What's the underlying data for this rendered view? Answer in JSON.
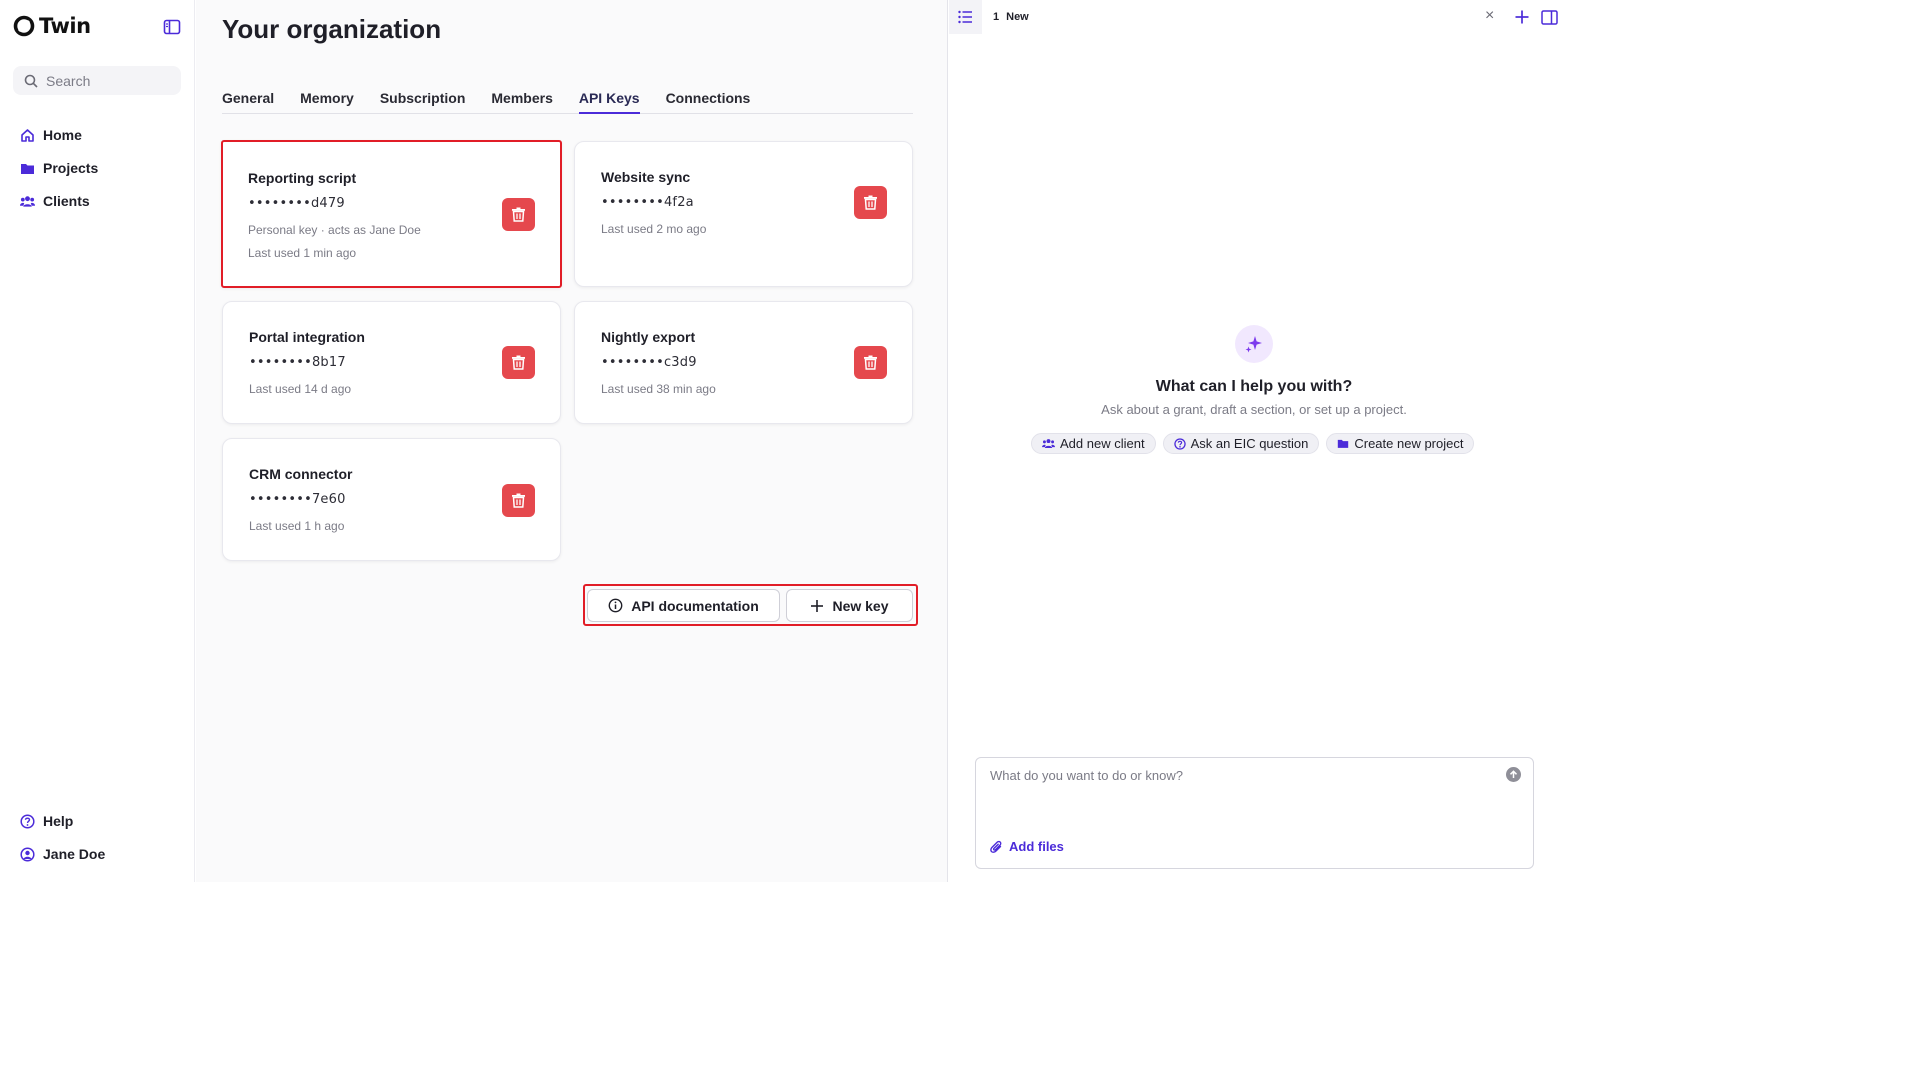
{
  "app": {
    "brand": "Twin"
  },
  "colors": {
    "accent": "#4b2bd9",
    "danger": "#e5484d",
    "highlight": "#e11d27",
    "purple_icon": "#7c3aed"
  },
  "sidebar": {
    "search_placeholder": "Search",
    "items": [
      {
        "label": "Home",
        "icon": "home-icon"
      },
      {
        "label": "Projects",
        "icon": "folder-icon"
      },
      {
        "label": "Clients",
        "icon": "users-icon"
      }
    ],
    "bottom": [
      {
        "label": "Help",
        "icon": "help-circle-icon"
      },
      {
        "label": "Jane Doe",
        "icon": "user-circle-icon"
      }
    ]
  },
  "main": {
    "title": "Your organization",
    "tabs": [
      {
        "label": "General"
      },
      {
        "label": "Memory"
      },
      {
        "label": "Subscription"
      },
      {
        "label": "Members"
      },
      {
        "label": "API Keys",
        "active": true
      },
      {
        "label": "Connections"
      }
    ],
    "keys": [
      {
        "name": "Reporting script",
        "key": "••••••••d479",
        "note": "Personal key · acts as Jane Doe",
        "last_used": "Last used 1 min ago",
        "highlighted": true
      },
      {
        "name": "Website sync",
        "key": "••••••••4f2a",
        "last_used": "Last used 2 mo ago"
      },
      {
        "name": "Portal integration",
        "key": "••••••••8b17",
        "last_used": "Last used 14 d ago"
      },
      {
        "name": "Nightly export",
        "key": "••••••••c3d9",
        "last_used": "Last used 38 min ago"
      },
      {
        "name": "CRM connector",
        "key": "••••••••7e60",
        "last_used": "Last used 1 h ago"
      }
    ],
    "actions": {
      "docs_label": "API documentation",
      "new_key_label": "New key"
    }
  },
  "right_panel": {
    "tab_number": "1",
    "tab_label": "New",
    "close_glyph": "×",
    "help_title": "What can I help you with?",
    "help_sub": "Ask about a grant, draft a section, or set up a project.",
    "chips": [
      {
        "label": "Add new client",
        "icon": "users-icon"
      },
      {
        "label": "Ask an EIC question",
        "icon": "help-circle-icon"
      },
      {
        "label": "Create new project",
        "icon": "folder-icon"
      }
    ],
    "composer_placeholder": "What do you want to do or know?",
    "add_files_label": "Add files"
  }
}
